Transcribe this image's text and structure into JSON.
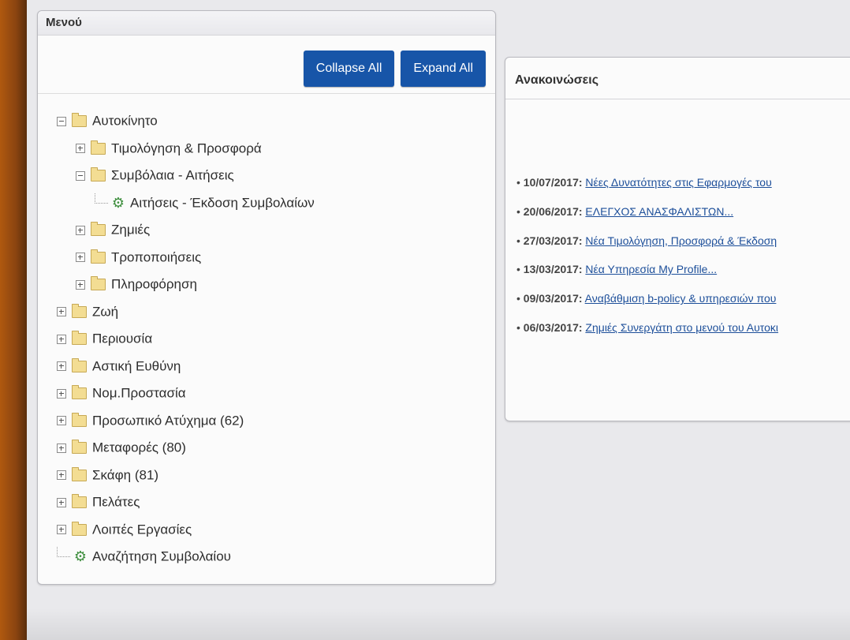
{
  "menu": {
    "title": "Μενού",
    "collapse_label": "Collapse All",
    "expand_label": "Expand All",
    "tree": [
      {
        "label": "Αυτοκίνητο",
        "level": 0,
        "kind": "folder",
        "state": "expanded"
      },
      {
        "label": "Τιμολόγηση & Προσφορά",
        "level": 1,
        "kind": "folder",
        "state": "collapsed"
      },
      {
        "label": "Συμβόλαια - Αιτήσεις",
        "level": 1,
        "kind": "folder",
        "state": "expanded"
      },
      {
        "label": "Αιτήσεις - Έκδοση Συμβολαίων",
        "level": 2,
        "kind": "gear",
        "state": "leaf"
      },
      {
        "label": "Ζημιές",
        "level": 1,
        "kind": "folder",
        "state": "collapsed"
      },
      {
        "label": "Τροποποιήσεις",
        "level": 1,
        "kind": "folder",
        "state": "collapsed"
      },
      {
        "label": "Πληροφόρηση",
        "level": 1,
        "kind": "folder",
        "state": "collapsed"
      },
      {
        "label": "Ζωή",
        "level": 0,
        "kind": "folder",
        "state": "collapsed"
      },
      {
        "label": "Περιουσία",
        "level": 0,
        "kind": "folder",
        "state": "collapsed"
      },
      {
        "label": "Αστική Ευθύνη",
        "level": 0,
        "kind": "folder",
        "state": "collapsed"
      },
      {
        "label": "Νομ.Προστασία",
        "level": 0,
        "kind": "folder",
        "state": "collapsed"
      },
      {
        "label": "Προσωπικό Ατύχημα (62)",
        "level": 0,
        "kind": "folder",
        "state": "collapsed"
      },
      {
        "label": "Μεταφορές (80)",
        "level": 0,
        "kind": "folder",
        "state": "collapsed"
      },
      {
        "label": "Σκάφη (81)",
        "level": 0,
        "kind": "folder",
        "state": "collapsed"
      },
      {
        "label": "Πελάτες",
        "level": 0,
        "kind": "folder",
        "state": "collapsed"
      },
      {
        "label": "Λοιπές Εργασίες",
        "level": 0,
        "kind": "folder",
        "state": "collapsed"
      },
      {
        "label": "Αναζήτηση Συμβολαίου",
        "level": 0,
        "kind": "gear",
        "state": "leaf"
      }
    ]
  },
  "announcements": {
    "title": "Ανακοινώσεις",
    "items": [
      {
        "date": "10/07/2017:",
        "text": "Νέες Δυνατότητες στις Εφαρμογές του"
      },
      {
        "date": "20/06/2017:",
        "text": "ΕΛΕΓΧΟΣ ΑΝΑΣΦΑΛΙΣΤΩΝ..."
      },
      {
        "date": "27/03/2017:",
        "text": "Νέα Τιμολόγηση, Προσφορά & Έκδοση"
      },
      {
        "date": "13/03/2017:",
        "text": "Νέα Υπηρεσία My Profile..."
      },
      {
        "date": "09/03/2017:",
        "text": "Αναβάθμιση b-policy & υπηρεσιών που"
      },
      {
        "date": "06/03/2017:",
        "text": "Ζημιές Συνεργάτη στο μενού του Αυτοκι"
      }
    ]
  },
  "icons": {
    "expander_expanded": "minus-box-icon",
    "expander_collapsed": "plus-box-icon",
    "folder": "folder-icon",
    "leaf": "gear-icon"
  },
  "colors": {
    "button_bg": "#1755a8",
    "link": "#1d4f9a",
    "folder": "#f3dd93",
    "gear": "#3f8f3f"
  }
}
